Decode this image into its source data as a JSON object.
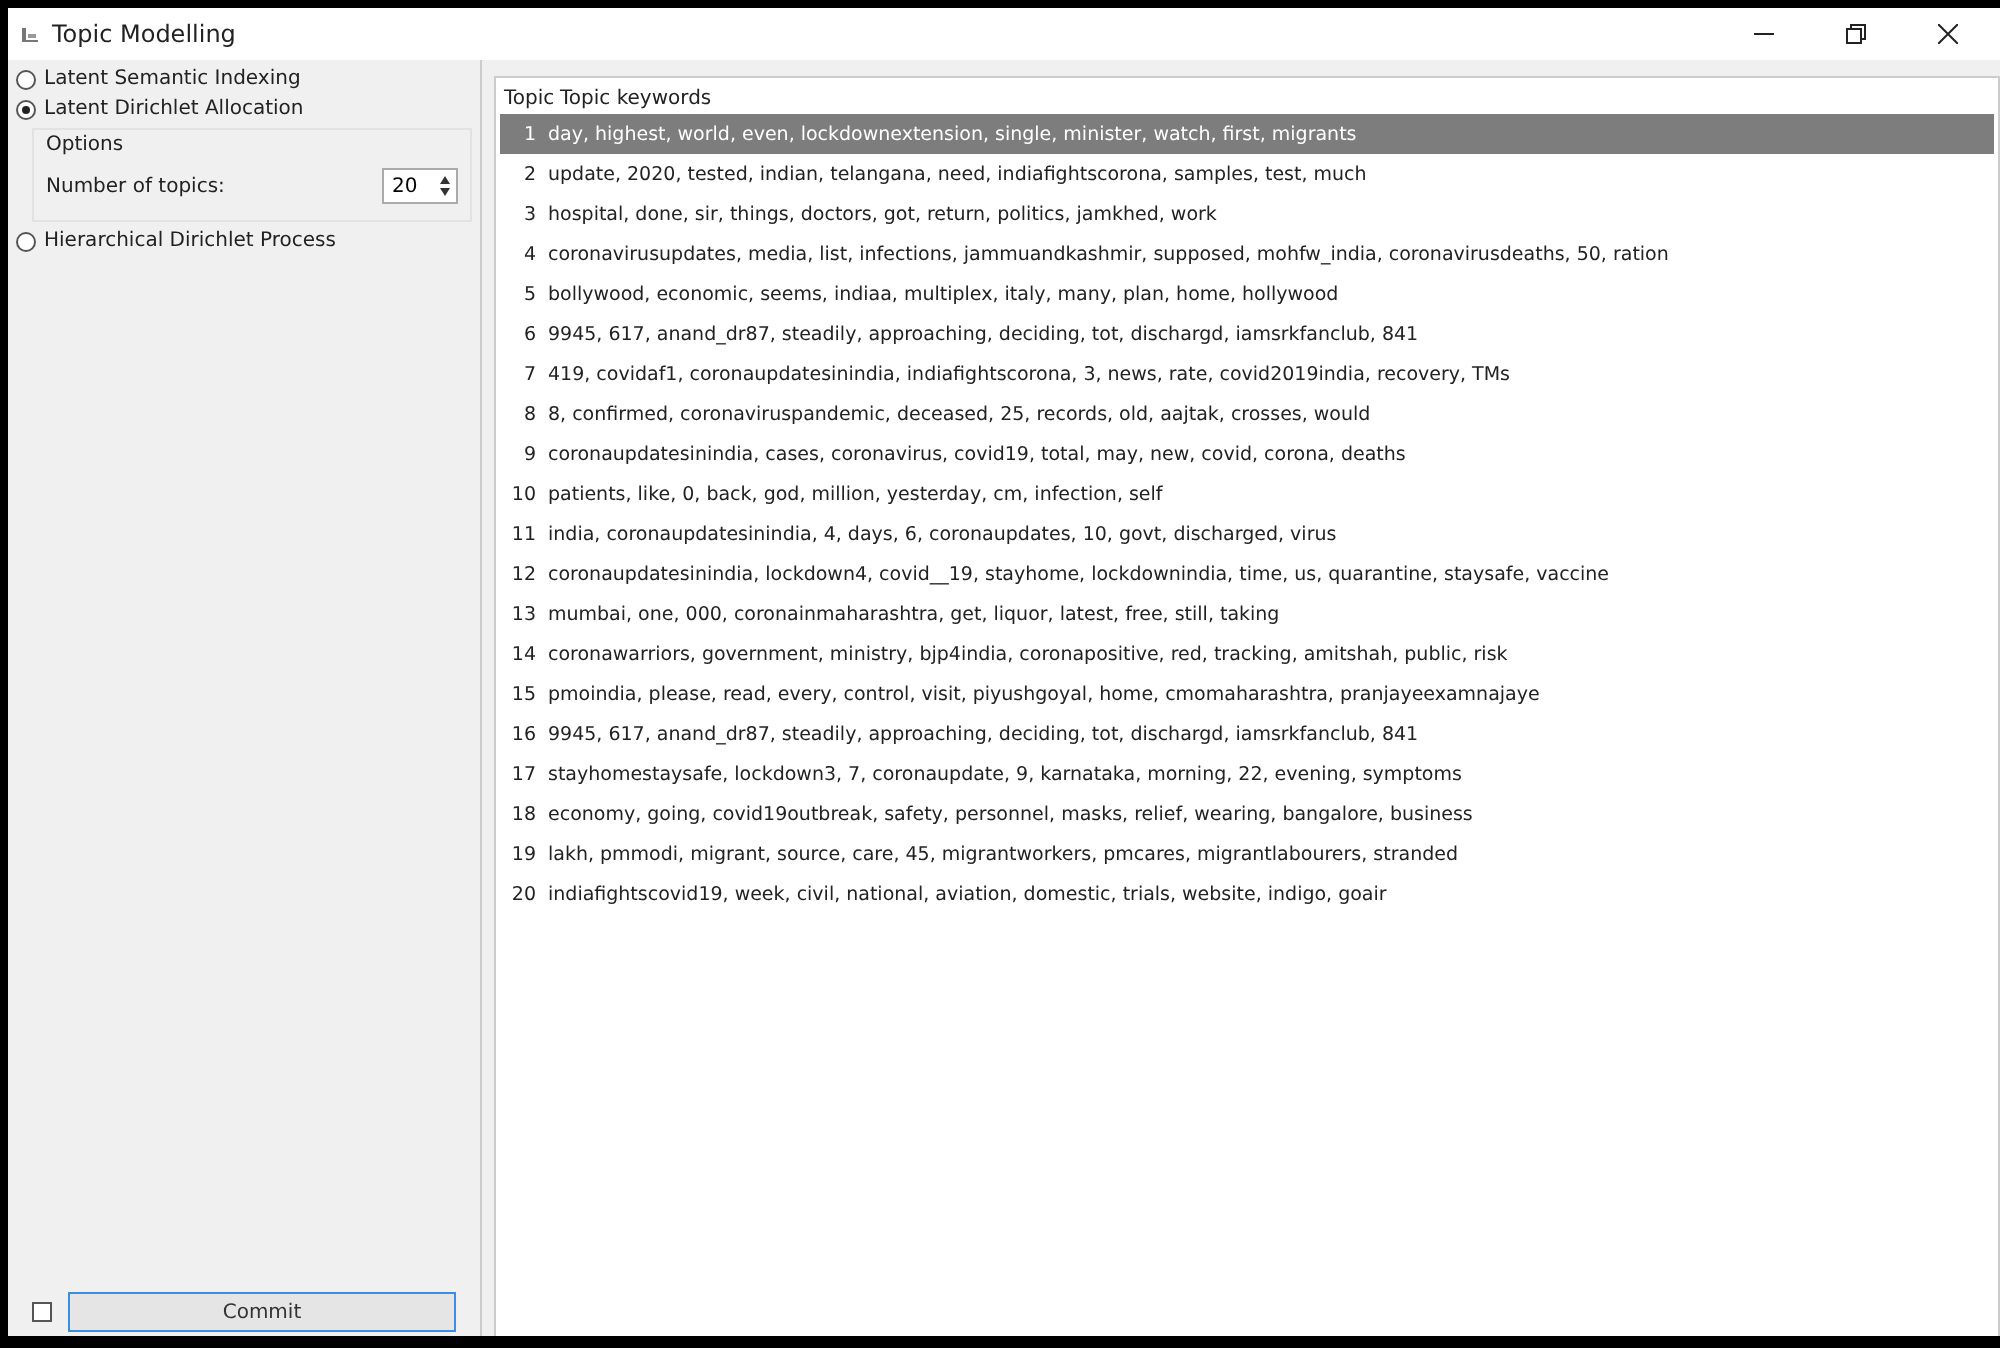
{
  "window": {
    "title": "Topic Modelling"
  },
  "methods": [
    {
      "label": "Latent Semantic Indexing",
      "selected": false
    },
    {
      "label": "Latent Dirichlet Allocation",
      "selected": true
    },
    {
      "label": "Hierarchical Dirichlet Process",
      "selected": false
    }
  ],
  "options": {
    "title": "Options",
    "label": "Number of topics:",
    "value": "20"
  },
  "auto_commit": {
    "checked": false
  },
  "commit_button": "Commit",
  "table": {
    "columns": [
      "Topic",
      "Topic keywords"
    ],
    "rows": [
      {
        "topic": "1",
        "keywords": "day, highest, world, even, lockdownextension, single, minister, watch, first, migrants",
        "selected": true
      },
      {
        "topic": "2",
        "keywords": "update, 2020, tested, indian, telangana, need, indiafightscorona, samples, test, much",
        "selected": false
      },
      {
        "topic": "3",
        "keywords": "hospital, done, sir, things, doctors, got, return, politics, jamkhed, work",
        "selected": false
      },
      {
        "topic": "4",
        "keywords": "coronavirusupdates, media, list, infections, jammuandkashmir, supposed, mohfw_india, coronavirusdeaths, 50, ration",
        "selected": false
      },
      {
        "topic": "5",
        "keywords": "bollywood, economic, seems, indiaa, multiplex, italy, many, plan, home, hollywood",
        "selected": false
      },
      {
        "topic": "6",
        "keywords": "9945, 617, anand_dr87, steadily, approaching, deciding, tot, dischargd, iamsrkfanclub, 841",
        "selected": false
      },
      {
        "topic": "7",
        "keywords": "419, covidaf1, coronaupdatesinindia, indiafightscorona, 3, news, rate, covid2019india, recovery, TMs",
        "selected": false
      },
      {
        "topic": "8",
        "keywords": "8, confirmed, coronaviruspandemic, deceased, 25, records, old, aajtak, crosses, would",
        "selected": false
      },
      {
        "topic": "9",
        "keywords": "coronaupdatesinindia, cases, coronavirus, covid19, total, may, new, covid, corona, deaths",
        "selected": false
      },
      {
        "topic": "10",
        "keywords": "patients, like, 0, back, god, million, yesterday, cm, infection, self",
        "selected": false
      },
      {
        "topic": "11",
        "keywords": "india, coronaupdatesinindia, 4, days, 6, coronaupdates, 10, govt, discharged, virus",
        "selected": false
      },
      {
        "topic": "12",
        "keywords": "coronaupdatesinindia, lockdown4, covid__19, stayhome, lockdownindia, time, us, quarantine, staysafe, vaccine",
        "selected": false
      },
      {
        "topic": "13",
        "keywords": "mumbai, one, 000, coronainmaharashtra, get, liquor, latest, free, still, taking",
        "selected": false
      },
      {
        "topic": "14",
        "keywords": "coronawarriors, government, ministry, bjp4india, coronapositive, red, tracking, amitshah, public, risk",
        "selected": false
      },
      {
        "topic": "15",
        "keywords": "pmoindia, please, read, every, control, visit, piyushgoyal, home, cmomaharashtra, pranjayeexamnajaye",
        "selected": false
      },
      {
        "topic": "16",
        "keywords": "9945, 617, anand_dr87, steadily, approaching, deciding, tot, dischargd, iamsrkfanclub, 841",
        "selected": false
      },
      {
        "topic": "17",
        "keywords": "stayhomestaysafe, lockdown3, 7, coronaupdate, 9, karnataka, morning, 22, evening, symptoms",
        "selected": false
      },
      {
        "topic": "18",
        "keywords": "economy, going, covid19outbreak, safety, personnel, masks, relief, wearing, bangalore, business",
        "selected": false
      },
      {
        "topic": "19",
        "keywords": "lakh, pmmodi, migrant, source, care, 45, migrantworkers, pmcares, migrantlabourers, stranded",
        "selected": false
      },
      {
        "topic": "20",
        "keywords": "indiafightscovid19, week, civil, national, aviation, domestic, trials, website, indigo, goair",
        "selected": false
      }
    ]
  }
}
